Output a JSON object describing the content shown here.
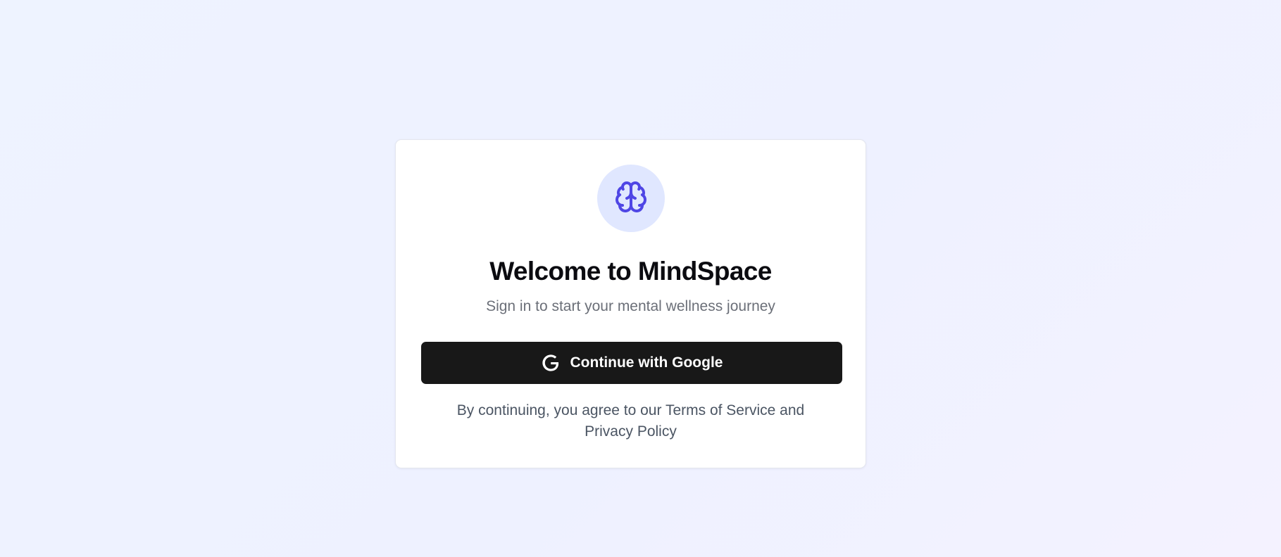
{
  "icons": {
    "logo": "brain-icon",
    "google": "google-g-icon"
  },
  "colors": {
    "accent": "#4f46e5",
    "logo_bg": "#e0e7ff",
    "button_bg": "#181818"
  },
  "card": {
    "title": "Welcome to MindSpace",
    "subtitle": "Sign in to start your mental wellness journey",
    "button_label": "Continue with Google",
    "terms": {
      "prefix": "By continuing, you agree to our",
      "tos_link": "Terms of Service",
      "connector": "and",
      "privacy_link": "Privacy Policy"
    }
  }
}
